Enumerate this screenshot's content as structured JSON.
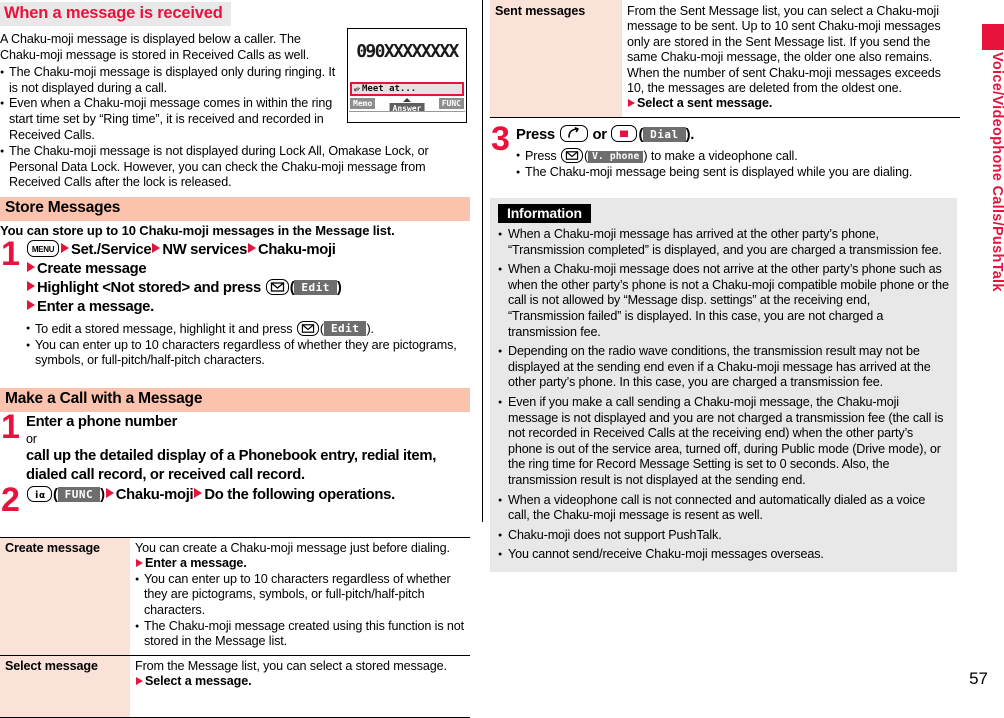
{
  "page_number": "57",
  "side_tab": {
    "label": "Voice/Videophone Calls/PushTalk",
    "color": "#e8133c"
  },
  "left": {
    "section1": {
      "title": "When a message is received",
      "intro": "A Chaku-moji message is displayed below a caller. The Chaku-moji message is stored in Received Calls as well.",
      "bullets": [
        "The Chaku-moji message is displayed only during ringing. It is not displayed during a call.",
        "Even when a Chaku-moji message comes in within the ring start time set by “Ring time”, it is received and recorded in Received Calls.",
        "The Chaku-moji message is not displayed during Lock All, Omakase Lock, or Personal Data Lock. However, you can check the Chaku-moji message from Received Calls after the lock is released."
      ],
      "phone_screen": {
        "number": "090XXXXXXXX",
        "message": "Meet at...",
        "softkey_left": "Memo",
        "softkey_center": "Answer",
        "softkey_right": "FUNC"
      }
    },
    "section2": {
      "title": "Store Messages",
      "intro": "You can store up to 10 Chaku-moji messages in the Message list.",
      "step_number": "1",
      "step_lines": [
        "Set./Service",
        "NW services",
        "Chaku-moji",
        "Create message",
        "Highlight <Not stored> and press",
        "Enter a message."
      ],
      "menu_key_label": "MENU",
      "edit_softkey": "Edit",
      "bullets": [
        "To edit a stored message, highlight it and press",
        "You can enter up to 10 characters regardless of whether they are pictograms, symbols, or full-pitch/half-pitch characters."
      ],
      "bullet1_tail": ")."
    },
    "section3": {
      "title": "Make a Call with a Message",
      "step1_number": "1",
      "step1_line1": "Enter a phone number",
      "step1_or": "or",
      "step1_line2": "call up the detailed display of a Phonebook entry, redial item, dialed call record, or received call record.",
      "step2_number": "2",
      "func_softkey": "FUNC",
      "step2_part1": "Chaku-moji",
      "step2_part2": "Do the following operations."
    },
    "table": {
      "rows": [
        {
          "key": "Create message",
          "intro": "You can create a Chaku-moji message just before dialing.",
          "action": "Enter a message.",
          "bullets": [
            "You can enter up to 10 characters regardless of whether they are pictograms, symbols, or full-pitch/half-pitch characters.",
            "The Chaku-moji message created using this function is not stored in the Message list."
          ]
        },
        {
          "key": "Select message",
          "intro": "From the Message list, you can select a stored message.",
          "action": "Select a message.",
          "bullets": []
        }
      ]
    }
  },
  "right": {
    "table": {
      "rows": [
        {
          "key": "Sent messages",
          "intro": "From the Sent Message list, you can select a Chaku-moji message to be sent. Up to 10 sent Chaku-moji messages only are stored in the Sent Message list. If you send the same Chaku-moji message, the older one also remains. When the number of sent Chaku-moji messages exceeds 10, the messages are deleted from the oldest one.",
          "action": "Select a sent message."
        }
      ]
    },
    "step3": {
      "number": "3",
      "press_label": "Press",
      "or_label": "or",
      "dial_softkey": "Dial",
      "period": ").",
      "bullets": [
        {
          "pre": "Press",
          "softkey": "V. phone",
          "post": ") to make a videophone call."
        },
        {
          "pre": "The Chaku-moji message being sent is displayed while you are dialing.",
          "softkey": "",
          "post": ""
        }
      ]
    },
    "information": {
      "title": "Information",
      "items": [
        "When a Chaku-moji message has arrived at the other party’s phone, “Transmission completed” is displayed, and you are charged a transmission fee.",
        "When a Chaku-moji message does not arrive at the other party’s phone such as when the other party’s phone is not a Chaku-moji compatible mobile phone or the call is not allowed by “Message disp. settings” at the receiving end, “Transmission failed” is displayed. In this case, you are not charged a transmission fee.",
        "Depending on the radio wave conditions, the transmission result may not be displayed at the sending end even if a Chaku-moji message has arrived at the other party’s phone. In this case, you are charged a transmission fee.",
        "Even if you make a call sending a Chaku-moji message, the Chaku-moji message is not displayed and you are not charged a transmission fee (the call is not recorded in Received Calls at the receiving end) when the other party’s phone is out of the service area, turned off, during Public mode (Drive mode), or the ring time for Record Message Setting is set to 0 seconds. Also, the transmission result is not displayed at the sending end.",
        "When a videophone call is not connected and automatically dialed as a voice call, the Chaku-moji message is resent as well.",
        "Chaku-moji does not support PushTalk.",
        "You cannot send/receive Chaku-moji messages overseas."
      ]
    }
  }
}
